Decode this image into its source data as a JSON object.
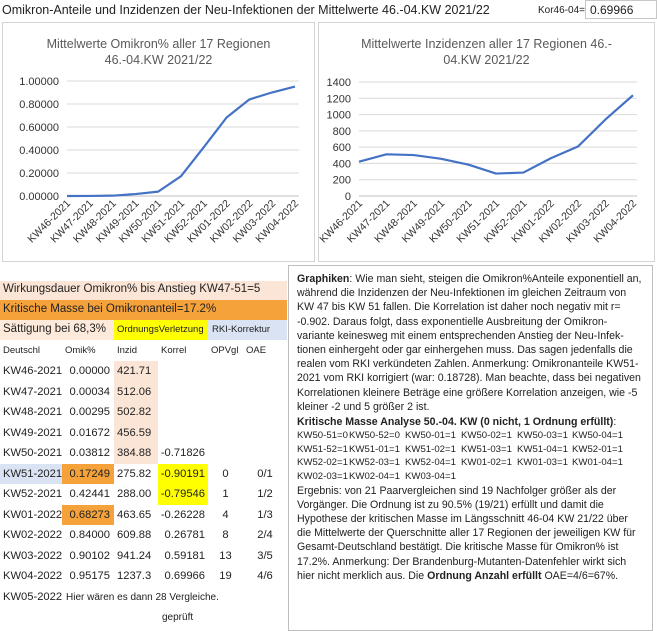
{
  "header": {
    "title": "Omikron-Anteile und Inzidenzen der Neu-Infektionen der Mittelwerte 46.-04.KW 2021/22",
    "corr_label": "Kor46-04=",
    "corr_value": "0.69966"
  },
  "colors": {
    "line": "#4472c4",
    "orange": "#f5a23b",
    "yellow": "#ffff00",
    "peach": "#fbe5d6",
    "blue_tint": "#dae3f3",
    "light_orange": "#fdeada"
  },
  "chart_data": [
    {
      "type": "line",
      "title": "Mittelwerte Omikron% aller 17 Regionen 46.-04.KW 2021/22",
      "title_lines": [
        "Mittelwerte Omikron% aller 17 Regionen",
        "46.-04.KW 2021/22"
      ],
      "categories": [
        "KW46-2021",
        "KW47-2021",
        "KW48-2021",
        "KW49-2021",
        "KW50-2021",
        "KW51-2021",
        "KW52-2021",
        "KW01-2022",
        "KW02-2022",
        "KW03-2022",
        "KW04-2022"
      ],
      "values": [
        0.0,
        0.00034,
        0.00295,
        0.01672,
        0.03812,
        0.17249,
        0.42441,
        0.68273,
        0.84,
        0.90102,
        0.95175
      ],
      "ylim": [
        0,
        1
      ],
      "yticks": [
        "0.00000",
        "0.20000",
        "0.40000",
        "0.60000",
        "0.80000",
        "1.00000"
      ],
      "grid": true,
      "legend": "none"
    },
    {
      "type": "line",
      "title": "Mittelwerte Inzidenzen aller 17 Regionen 46.-04.KW 2021/22",
      "title_lines": [
        "Mittelwerte Inzidenzen aller 17 Regionen 46.-",
        "04.KW 2021/22"
      ],
      "categories": [
        "KW46-2021",
        "KW47-2021",
        "KW48-2021",
        "KW49-2021",
        "KW50-2021",
        "KW51-2021",
        "KW52-2021",
        "KW01-2022",
        "KW02-2022",
        "KW03-2022",
        "KW04-2022"
      ],
      "values": [
        421.71,
        512.06,
        502.82,
        456.59,
        384.88,
        275.82,
        288.0,
        463.65,
        609.88,
        941.24,
        1237.3
      ],
      "ylim": [
        0,
        1400
      ],
      "yticks": [
        "0",
        "200",
        "400",
        "600",
        "800",
        "1000",
        "1200",
        "1400"
      ],
      "grid": true,
      "legend": "none"
    }
  ],
  "left_panel": {
    "line1": "Wirkungsdauer Omikron% bis Anstieg KW47-51=5",
    "line2": "Kritische Masse bei Omikronanteil=17.2%",
    "line3_a": "Sättigung bei 68,3%",
    "line3_b": "OrdnungsVerletzung",
    "line3_c": "RKI-Korrektur",
    "headers": [
      "Deutschl",
      "Omik%",
      "Inzid",
      "Korrel",
      "OPVgl",
      "OAE"
    ],
    "rows": [
      [
        "KW46-2021",
        "0.00000",
        "421.71",
        "",
        "",
        ""
      ],
      [
        "KW47-2021",
        "0.00034",
        "512.06",
        "",
        "",
        ""
      ],
      [
        "KW48-2021",
        "0.00295",
        "502.82",
        "",
        "",
        ""
      ],
      [
        "KW49-2021",
        "0.01672",
        "456.59",
        "",
        "",
        ""
      ],
      [
        "KW50-2021",
        "0.03812",
        "384.88",
        "-0.71826",
        "",
        ""
      ],
      [
        "KW51-2021",
        "0.17249",
        "275.82",
        "-0.90191",
        "0",
        "0/1"
      ],
      [
        "KW52-2021",
        "0.42441",
        "288.00",
        "-0.79546",
        "1",
        "1/2"
      ],
      [
        "KW01-2022",
        "0.68273",
        "463.65",
        "-0.26228",
        "4",
        "1/3"
      ],
      [
        "KW02-2022",
        "0.84000",
        "609.88",
        "0.26781",
        "8",
        "2/4"
      ],
      [
        "KW03-2022",
        "0.90102",
        "941.24",
        "0.59181",
        "13",
        "3/5"
      ],
      [
        "KW04-2022",
        "0.95175",
        "1237.3",
        "0.69966",
        "19",
        "4/6"
      ]
    ],
    "last_row_label": "KW05-2022",
    "last_row_note": "Hier wären es dann 28 Vergleiche.",
    "footer": "geprüft"
  },
  "textbox": {
    "p1_bold": "Graphiken",
    "p1_text": ": Wie man sieht, steigen die Omikron%Anteile exponentiell an, während die Inzidenzen der Neu-Infektionen im gleichen Zeitraum von KW 47 bis KW 51 fallen. Die Korrelation ist daher noch negativ mit r= -0.902. Daraus folgt, dass exponentielle Ausbreitung der Omikron-variante keinesweg mit einem entsprechenden Anstieg der Neu-Infek-tionen einhergeht oder gar einhergehen muss. Das sagen jedenfalls die realen vom RKI verkündeten Zahlen. Anmerkung: Omikronanteile KW51-2021 vom RKI korrigiert (war: 0.18728). Man beachte, dass bei negativen Korrelationen kleinere Beträge eine größere Korrelation anzeigen, wie -5 kleiner -2 und 5 größer 2 ist.",
    "p2_bold": "Kritische Masse Analyse 50.-04. KW  (0 nicht, 1 Ordnung erfüllt)",
    "p2_colon": ":",
    "grid": [
      [
        "KW50-51=0",
        "KW50-52=0",
        "KW50-01=1",
        "KW50-02=1",
        "KW50-03=1",
        "KW50-04=1"
      ],
      [
        "KW51-52=1",
        "KW51-01=1",
        "KW51-02=1",
        "KW51-03=1",
        "KW51-04=1",
        "KW52-01=1"
      ],
      [
        "KW52-02=1",
        "KW52-03=1",
        "KW52-04=1",
        "KW01-02=1",
        "KW01-03=1",
        "KW01-04=1"
      ],
      [
        "KW02-03=1",
        "KW02-04=1",
        "KW03-04=1",
        "",
        "",
        ""
      ]
    ],
    "p3_text": "Ergebnis: von 21 Paarvergleichen sind 19 Nachfolger größer als der Vorgänger. Die Ordnung ist zu 90.5% (19/21) erfüllt und damit die Hypothese der kritischen Masse im Längsschnitt 46-04 KW 21/22 über die Mittelwerte der Querschnitte aller 17 Regionen der jeweiligen KW für Gesamt-Deutschland bestätigt. Die kritische Masse für Omikron% ist 17.2%. Anmerkung: Der Brandenburg-Mutanten-Datenfehler wirkt sich hier nicht merklich aus. Die ",
    "p3_bold": "Ordnung Anzahl erfüllt",
    "p3_tail": " OAE=4/6=67%."
  }
}
